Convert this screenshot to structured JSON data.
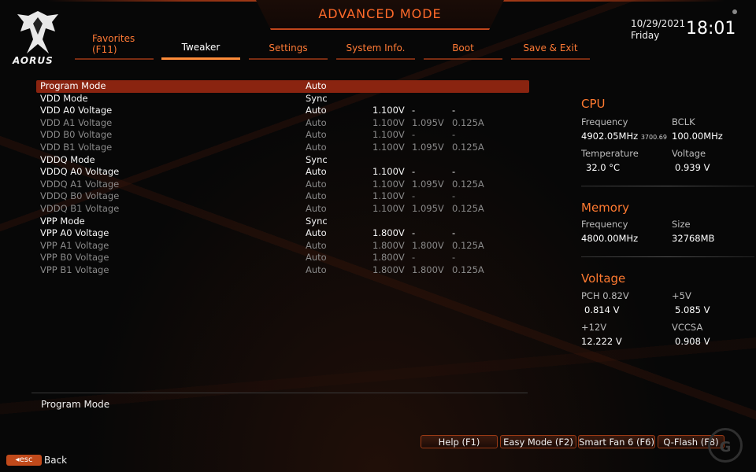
{
  "header": {
    "mode_title": "ADVANCED MODE",
    "logo_text": "AORUS",
    "date": "10/29/2021",
    "day": "Friday",
    "time": "18:01"
  },
  "tabs": [
    {
      "label": "Favorites",
      "sublabel": "(F11)"
    },
    {
      "label": "Tweaker",
      "active": true
    },
    {
      "label": "Settings"
    },
    {
      "label": "System Info."
    },
    {
      "label": "Boot"
    },
    {
      "label": "Save & Exit"
    }
  ],
  "settings": [
    {
      "name": "Program Mode",
      "value": "Auto",
      "c1": "",
      "c2": "",
      "c3": "",
      "state": "highlight"
    },
    {
      "name": "VDD Mode",
      "value": "Sync",
      "c1": "",
      "c2": "",
      "c3": "",
      "state": "bright"
    },
    {
      "name": "VDD A0 Voltage",
      "value": "Auto",
      "c1": "1.100V",
      "c2": "-",
      "c3": "-",
      "state": "bright"
    },
    {
      "name": "VDD A1 Voltage",
      "value": "Auto",
      "c1": "1.100V",
      "c2": "1.095V",
      "c3": "0.125A",
      "state": "dim"
    },
    {
      "name": "VDD B0 Voltage",
      "value": "Auto",
      "c1": "1.100V",
      "c2": "-",
      "c3": "-",
      "state": "dim"
    },
    {
      "name": "VDD B1 Voltage",
      "value": "Auto",
      "c1": "1.100V",
      "c2": "1.095V",
      "c3": "0.125A",
      "state": "dim"
    },
    {
      "name": "VDDQ Mode",
      "value": "Sync",
      "c1": "",
      "c2": "",
      "c3": "",
      "state": "bright"
    },
    {
      "name": "VDDQ A0 Voltage",
      "value": "Auto",
      "c1": "1.100V",
      "c2": "-",
      "c3": "-",
      "state": "bright"
    },
    {
      "name": "VDDQ A1 Voltage",
      "value": "Auto",
      "c1": "1.100V",
      "c2": "1.095V",
      "c3": "0.125A",
      "state": "dim"
    },
    {
      "name": "VDDQ B0 Voltage",
      "value": "Auto",
      "c1": "1.100V",
      "c2": "-",
      "c3": "-",
      "state": "dim"
    },
    {
      "name": "VDDQ B1 Voltage",
      "value": "Auto",
      "c1": "1.100V",
      "c2": "1.095V",
      "c3": "0.125A",
      "state": "dim"
    },
    {
      "name": "VPP Mode",
      "value": "Sync",
      "c1": "",
      "c2": "",
      "c3": "",
      "state": "bright"
    },
    {
      "name": "VPP A0 Voltage",
      "value": "Auto",
      "c1": "1.800V",
      "c2": "-",
      "c3": "-",
      "state": "bright"
    },
    {
      "name": "VPP A1 Voltage",
      "value": "Auto",
      "c1": "1.800V",
      "c2": "1.800V",
      "c3": "0.125A",
      "state": "dim"
    },
    {
      "name": "VPP B0 Voltage",
      "value": "Auto",
      "c1": "1.800V",
      "c2": "-",
      "c3": "-",
      "state": "dim"
    },
    {
      "name": "VPP B1 Voltage",
      "value": "Auto",
      "c1": "1.800V",
      "c2": "1.800V",
      "c3": "0.125A",
      "state": "dim"
    }
  ],
  "cpu": {
    "title": "CPU",
    "frequency_label": "Frequency",
    "frequency": "4902.05MHz",
    "frequency_sub": "3700.69",
    "bclk_label": "BCLK",
    "bclk": "100.00MHz",
    "temperature_label": "Temperature",
    "temperature": "32.0 °C",
    "voltage_label": "Voltage",
    "voltage": "0.939 V"
  },
  "memory": {
    "title": "Memory",
    "frequency_label": "Frequency",
    "frequency": "4800.00MHz",
    "size_label": "Size",
    "size": "32768MB"
  },
  "voltage": {
    "title": "Voltage",
    "pch_label": "PCH 0.82V",
    "pch": "0.814 V",
    "p5_label": "+5V",
    "p5": "5.085 V",
    "p12_label": "+12V",
    "p12": "12.222 V",
    "vccsa_label": "VCCSA",
    "vccsa": "0.908 V"
  },
  "description": "Program Mode",
  "bottom": {
    "help": "Help (F1)",
    "easy_mode": "Easy Mode (F2)",
    "smart_fan": "Smart Fan 6 (F6)",
    "qflash": "Q-Flash (F8)",
    "esc": "esc",
    "back": "Back"
  },
  "colors": {
    "accent": "#ff7a30",
    "highlight": "#8a2410",
    "dim_text": "#8a8a8a"
  }
}
